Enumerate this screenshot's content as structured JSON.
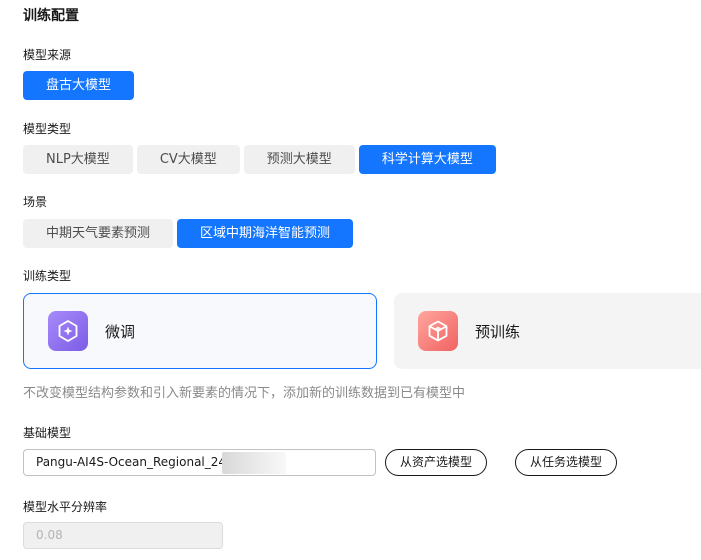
{
  "section": {
    "title": "训练配置"
  },
  "model_source": {
    "label": "模型来源",
    "options": [
      {
        "label": "盘古大模型",
        "active": true
      }
    ]
  },
  "model_type": {
    "label": "模型类型",
    "options": [
      {
        "label": "NLP大模型",
        "active": false
      },
      {
        "label": "CV大模型",
        "active": false
      },
      {
        "label": "预测大模型",
        "active": false
      },
      {
        "label": "科学计算大模型",
        "active": true
      }
    ]
  },
  "scene": {
    "label": "场景",
    "options": [
      {
        "label": "中期天气要素预测",
        "active": false
      },
      {
        "label": "区域中期海洋智能预测",
        "active": true
      }
    ]
  },
  "training_type": {
    "label": "训练类型",
    "cards": [
      {
        "label": "微调",
        "icon": "finetune-icon",
        "selected": true
      },
      {
        "label": "预训练",
        "icon": "pretrain-icon",
        "selected": false
      }
    ],
    "description": "不改变模型结构参数和引入新要素的情况下，添加新的训练数据到已有模型中"
  },
  "base_model": {
    "label": "基础模型",
    "value": "Pangu-AI4S-Ocean_Regional_24h-",
    "buttons": {
      "from_assets": "从资产选模型",
      "from_tasks": "从任务选模型"
    }
  },
  "horizontal_resolution": {
    "label": "模型水平分辨率",
    "value": "0.08"
  },
  "colors": {
    "accent": "#1476ff",
    "pill_bg": "#f0f0f0",
    "muted_text": "#8a8a8a"
  }
}
